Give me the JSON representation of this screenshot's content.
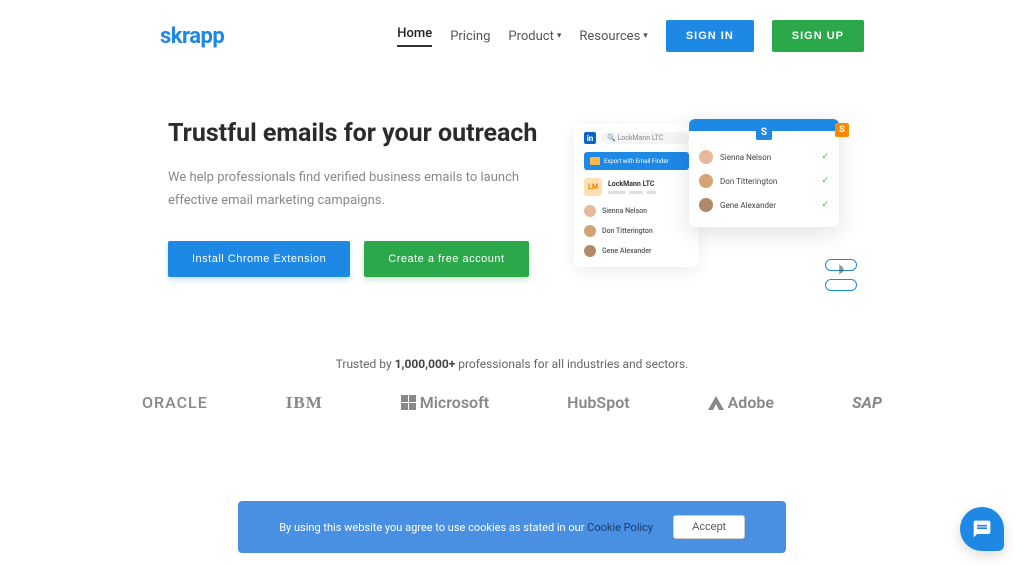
{
  "brand": "skrapp",
  "nav": {
    "home": "Home",
    "pricing": "Pricing",
    "product": "Product",
    "resources": "Resources",
    "signin": "SIGN IN",
    "signup": "SIGN UP"
  },
  "hero": {
    "title": "Trustful emails for your outreach",
    "subtitle": "We help professionals find verified business emails to launch effective email marketing campaigns.",
    "install_btn": "Install Chrome Extension",
    "create_btn": "Create a free account"
  },
  "illustration": {
    "search": "LockMann LTC",
    "export_label": "Export with Email Finder",
    "company_abbr": "LM",
    "company_name": "LockMann LTC",
    "people": [
      "Sienna Nelson",
      "Don Titterington",
      "Gene Alexander"
    ],
    "front_logo": "S",
    "badge": "S"
  },
  "trusted": {
    "prefix": "Trusted by ",
    "count": "1,000,000+",
    "suffix": " professionals for all industries and sectors."
  },
  "logos": {
    "oracle": "ORACLE",
    "ibm": "IBM",
    "microsoft": "Microsoft",
    "hubspot": "HubSpot",
    "adobe": "Adobe",
    "sap": "SAP"
  },
  "cookie": {
    "text": "By using this website you agree to use cookies as stated in our ",
    "link": "Cookie Policy",
    "accept": "Accept"
  }
}
